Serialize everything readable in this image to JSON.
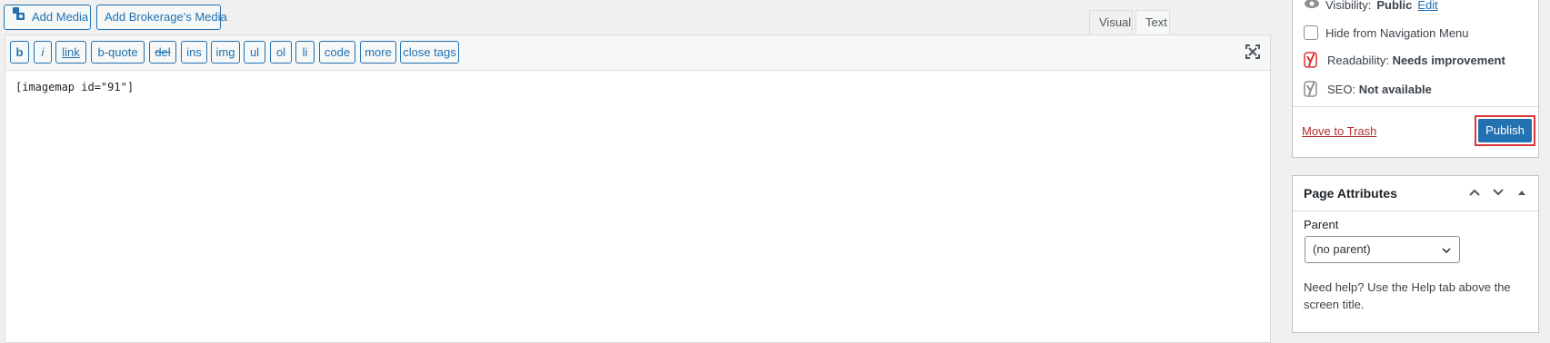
{
  "media": {
    "add_media": "Add Media",
    "add_brokerage_media": "Add Brokerage's Media"
  },
  "tabs": {
    "visual": "Visual",
    "text": "Text"
  },
  "quicktags": [
    "b",
    "i",
    "link",
    "b-quote",
    "del",
    "ins",
    "img",
    "ul",
    "ol",
    "li",
    "code",
    "more",
    "close tags"
  ],
  "editor": {
    "content": "[imagemap id=\"91\"]"
  },
  "publish_box": {
    "visibility_label": "Visibility:",
    "visibility_value": "Public",
    "visibility_edit": "Edit",
    "hide_nav": "Hide from Navigation Menu",
    "readability_label": "Readability:",
    "readability_value": "Needs improvement",
    "seo_label": "SEO:",
    "seo_value": "Not available",
    "move_to_trash": "Move to Trash",
    "publish": "Publish"
  },
  "page_attributes": {
    "title": "Page Attributes",
    "parent_label": "Parent",
    "parent_value": "(no parent)",
    "help_text": "Need help? Use the Help tab above the screen title."
  },
  "colors": {
    "accent": "#2271b1",
    "readability_bad": "#dc3232",
    "trash": "#b32d2e"
  },
  "icons": {
    "media": "media-icon",
    "fullscreen": "fullscreen-icon",
    "visibility": "eye-icon",
    "yoast": "yoast-icon"
  }
}
